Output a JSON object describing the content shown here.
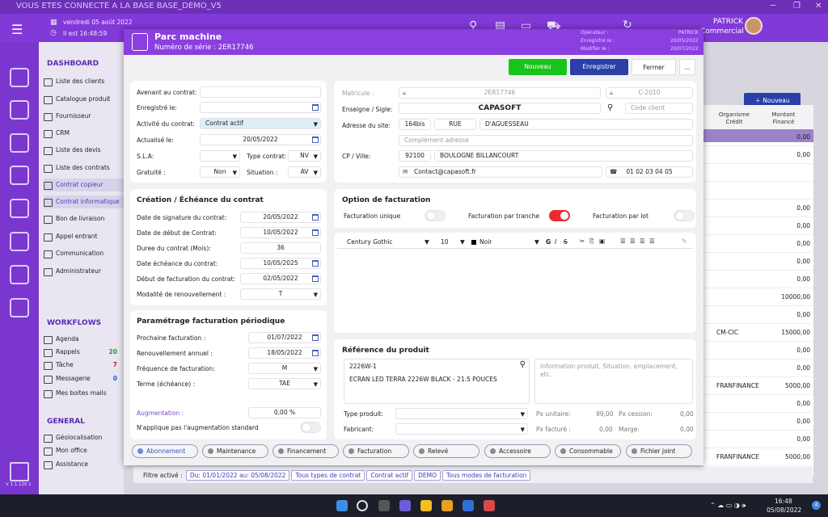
{
  "window": {
    "title": "VOUS ETES CONNECTE A LA BASE BASE_DEMO_V5"
  },
  "topbar": {
    "date": "vendredi 05 août 2022",
    "time": "Il est 16:48:59",
    "user_name": "PATRICK",
    "user_role": "Commercial"
  },
  "sidebar": {
    "sections": [
      {
        "title": "DASHBOARD",
        "items": [
          {
            "label": "Liste des clients"
          },
          {
            "label": "Catalogue produit"
          },
          {
            "label": "Fournisseur"
          },
          {
            "label": "CRM"
          },
          {
            "label": "Liste des devis"
          },
          {
            "label": "Liste des contrats"
          },
          {
            "label": "Contrat copieur"
          },
          {
            "label": "Contrat informatique"
          },
          {
            "label": "Bon de livraison"
          },
          {
            "label": "Appel entrant"
          },
          {
            "label": "Communication"
          },
          {
            "label": "Administrateur"
          }
        ]
      },
      {
        "title": "WORKFLOWS",
        "items": [
          {
            "label": "Agenda",
            "count": ""
          },
          {
            "label": "Rappels",
            "count": "20"
          },
          {
            "label": "Tâche",
            "count": "7"
          },
          {
            "label": "Messagerie",
            "count": "0"
          },
          {
            "label": "Mes boites mails",
            "count": ""
          }
        ]
      },
      {
        "title": "GENERAL",
        "items": [
          {
            "label": "Géolocalisation"
          },
          {
            "label": "Mon office"
          },
          {
            "label": "Assistance"
          }
        ]
      }
    ],
    "version": "V 1.1.120.1"
  },
  "background": {
    "new_button": "Nouveau",
    "col_organisme": "Organisme Crédit",
    "col_montant": "Montant Financé",
    "rows": [
      {
        "org": "",
        "amount": "0,00"
      },
      {
        "org": "",
        "amount": "0,00"
      },
      {
        "org": "",
        "amount": ""
      },
      {
        "org": "",
        "amount": ""
      },
      {
        "org": "",
        "amount": "0,00"
      },
      {
        "org": "",
        "amount": "0,00"
      },
      {
        "org": "",
        "amount": "0,00"
      },
      {
        "org": "",
        "amount": "0,00"
      },
      {
        "org": "",
        "amount": "0,00"
      },
      {
        "org": "",
        "amount": "10000,00"
      },
      {
        "org": "",
        "amount": "0,00"
      },
      {
        "org": "CM-CIC",
        "amount": "15000,00"
      },
      {
        "org": "",
        "amount": "0,00"
      },
      {
        "org": "",
        "amount": "0,00"
      },
      {
        "org": "FRANFINANCE",
        "amount": "5000,00"
      },
      {
        "org": "",
        "amount": "0,00"
      },
      {
        "org": "",
        "amount": "0,00"
      },
      {
        "org": "",
        "amount": "0,00"
      },
      {
        "org": "FRANFINANCE",
        "amount": "5000,00"
      }
    ],
    "filter": {
      "label": "Filtre activé :",
      "chips": [
        "Du: 01/01/2022 au: 05/08/2022",
        "Tous types de contrat",
        "Contrat actif",
        "DEMO",
        "Tous modes de facturation"
      ]
    }
  },
  "modal": {
    "title": "Parc machine",
    "serial": "Numéro de série : 2ER17746",
    "meta": {
      "operator_label": "Opérateur :",
      "operator_value": "PATRICK",
      "registered_label": "Enregistré le :",
      "registered_value": "20/05/2022",
      "modified_label": "Modifier le :",
      "modified_value": "20/07/2022"
    },
    "actions": {
      "new": "Nouveau",
      "save": "Enregistrer",
      "close": "Fermer",
      "more": "..."
    },
    "contract": {
      "avenant_label": "Avenant au contrat:",
      "avenant_value": "",
      "registered_label": "Enregistré le:",
      "registered_value": "",
      "activity_label": "Activité du contrat:",
      "activity_value": "Contrat actif",
      "updated_label": "Actualisé le:",
      "updated_value": "20/05/2022",
      "sla_label": "S.L.A:",
      "sla_value": "",
      "type_label": "Type contrat:",
      "type_value": "NV",
      "gratuity_label": "Gratuité :",
      "gratuity_value": "Non",
      "situation_label": "Situation :",
      "situation_value": "AV"
    },
    "creation": {
      "title": "Création / Échéance du contrat",
      "rows": [
        {
          "label": "Date de signature du contrat:",
          "value": "20/05/2022"
        },
        {
          "label": "Date de début de Contrat:",
          "value": "10/05/2022"
        },
        {
          "label": "Duree du contrat (Mois):",
          "value": "36"
        },
        {
          "label": "Date échéance du contrat:",
          "value": "10/05/2025"
        },
        {
          "label": "Début de facturation du contrat:",
          "value": "02/05/2022"
        },
        {
          "label": "Modalité de renouvellement :",
          "value": "T"
        }
      ]
    },
    "billing_params": {
      "title": "Paramétrage facturation périodique",
      "rows": [
        {
          "label": "Prochaine facturation :",
          "value": "01/07/2022"
        },
        {
          "label": "Renouvellement annuel :",
          "value": "18/05/2022"
        },
        {
          "label": "Fréquence de facturation:",
          "value": "M"
        },
        {
          "label": "Terme (échéance) :",
          "value": "TAE"
        }
      ],
      "increase_label": "Augmentation :",
      "increase_value": "0,00 %",
      "no_increase_label": "N'applique pas l'augmentation standard"
    },
    "client": {
      "matricule_label": "Matricule :",
      "matricule_value": "2ER17746",
      "ref_value": "C-2010",
      "sign_label": "Enseigne / Sigle:",
      "sign_value": "CAPASOFT",
      "client_code_placeholder": "Code client",
      "address_label": "Adresse du site:",
      "street_no": "164bis",
      "street_type": "RUE",
      "street_name": "D'AGUESSEAU",
      "address_complement_placeholder": "Complément adresse",
      "city_label": "CP / Ville:",
      "postal_code": "92100",
      "city": "BOULOGNE BILLANCOURT",
      "email": "Contact@capasoft.fr",
      "phone": "01 02 03 04 05"
    },
    "billing_options": {
      "title": "Option de facturation",
      "unique": "Facturation unique",
      "unique_on": false,
      "tranche": "Facturation par tranche",
      "tranche_on": true,
      "lot": "Facturation par lot",
      "lot_on": false
    },
    "editor": {
      "font": "Century Gothic",
      "size": "10",
      "color": "Noir",
      "bold": "G",
      "italic": "I",
      "strike": "S"
    },
    "product": {
      "title": "Référence du produit",
      "code": "2226W-1",
      "description": "ECRAN LED TERRA 2226W BLACK - 21.5 POUCES",
      "info_placeholder": "Information produit, Situation, emplacement, etc.",
      "type_label": "Type produit:",
      "type_value": "",
      "maker_label": "Fabricant:",
      "maker_value": "",
      "unit_price_label": "Px unitaire:",
      "unit_price": "99,00",
      "cession_label": "Px cession:",
      "cession_price": "0,00",
      "billed_label": "Px facturé :",
      "billed_price": "0,00",
      "margin_label": "Marge:",
      "margin": "0,00"
    },
    "tabs": [
      "Abonnement",
      "Maintenance",
      "Financement",
      "Facturation",
      "Relevé",
      "Accessoire",
      "Consommable",
      "Fichier joint"
    ]
  },
  "taskbar": {
    "time": "16:48",
    "date": "05/08/2022",
    "notifications": "4"
  }
}
